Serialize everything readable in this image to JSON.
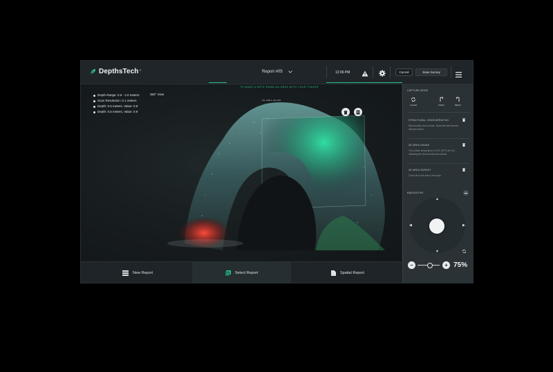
{
  "app": {
    "brand": "DepthsTech",
    "brand_mark": "®"
  },
  "header": {
    "report_title": "Report #05",
    "time": "12:06 PM",
    "cancel_label": "Cancel",
    "save_label": "Save Survey"
  },
  "viewport": {
    "hint": "TO MAKE A NOTE DRAW AN AREA WITH YOUR FINGER",
    "view_label": "360° View",
    "area_label": "3D AREA SHADE",
    "info": [
      "Depth Range: 0.5 - 2.0 meters",
      "Scan Resolution: 0.1 meters",
      "Depth: 0.5 meters, Value: 0.8",
      "Depth: 0.5 meters, Value: 0.9"
    ]
  },
  "bottom_bar": {
    "new_report": "New Report",
    "select_report": "Select Report",
    "spatial_report": "Spatial Report"
  },
  "panel": {
    "capture_title": "CAPTURE MODE",
    "tools": {
      "sync": "CLEAR",
      "undo": "UNDO",
      "redo": "REDO"
    },
    "notes": [
      {
        "title": "STRUCTURAL CONSIDERATION",
        "text": "Mineral walls show erosion. Moderate fault fissures detected above."
      },
      {
        "title": "3D AREA SHADE",
        "text": "The surface temperature is 10°C (50°F) at 9:30, indicating the observed thermal activity."
      },
      {
        "title": "3D AREA SURVEY",
        "text": "Check fill on the side of the slope."
      }
    ],
    "navigation_title": "NAVIGATION",
    "zoom": {
      "percent": "75%",
      "minus": "−",
      "plus": "+",
      "level": 0.75
    }
  },
  "colors": {
    "accent": "#2fbf8c",
    "background": "#1b2124",
    "panel": "#2b3235"
  }
}
